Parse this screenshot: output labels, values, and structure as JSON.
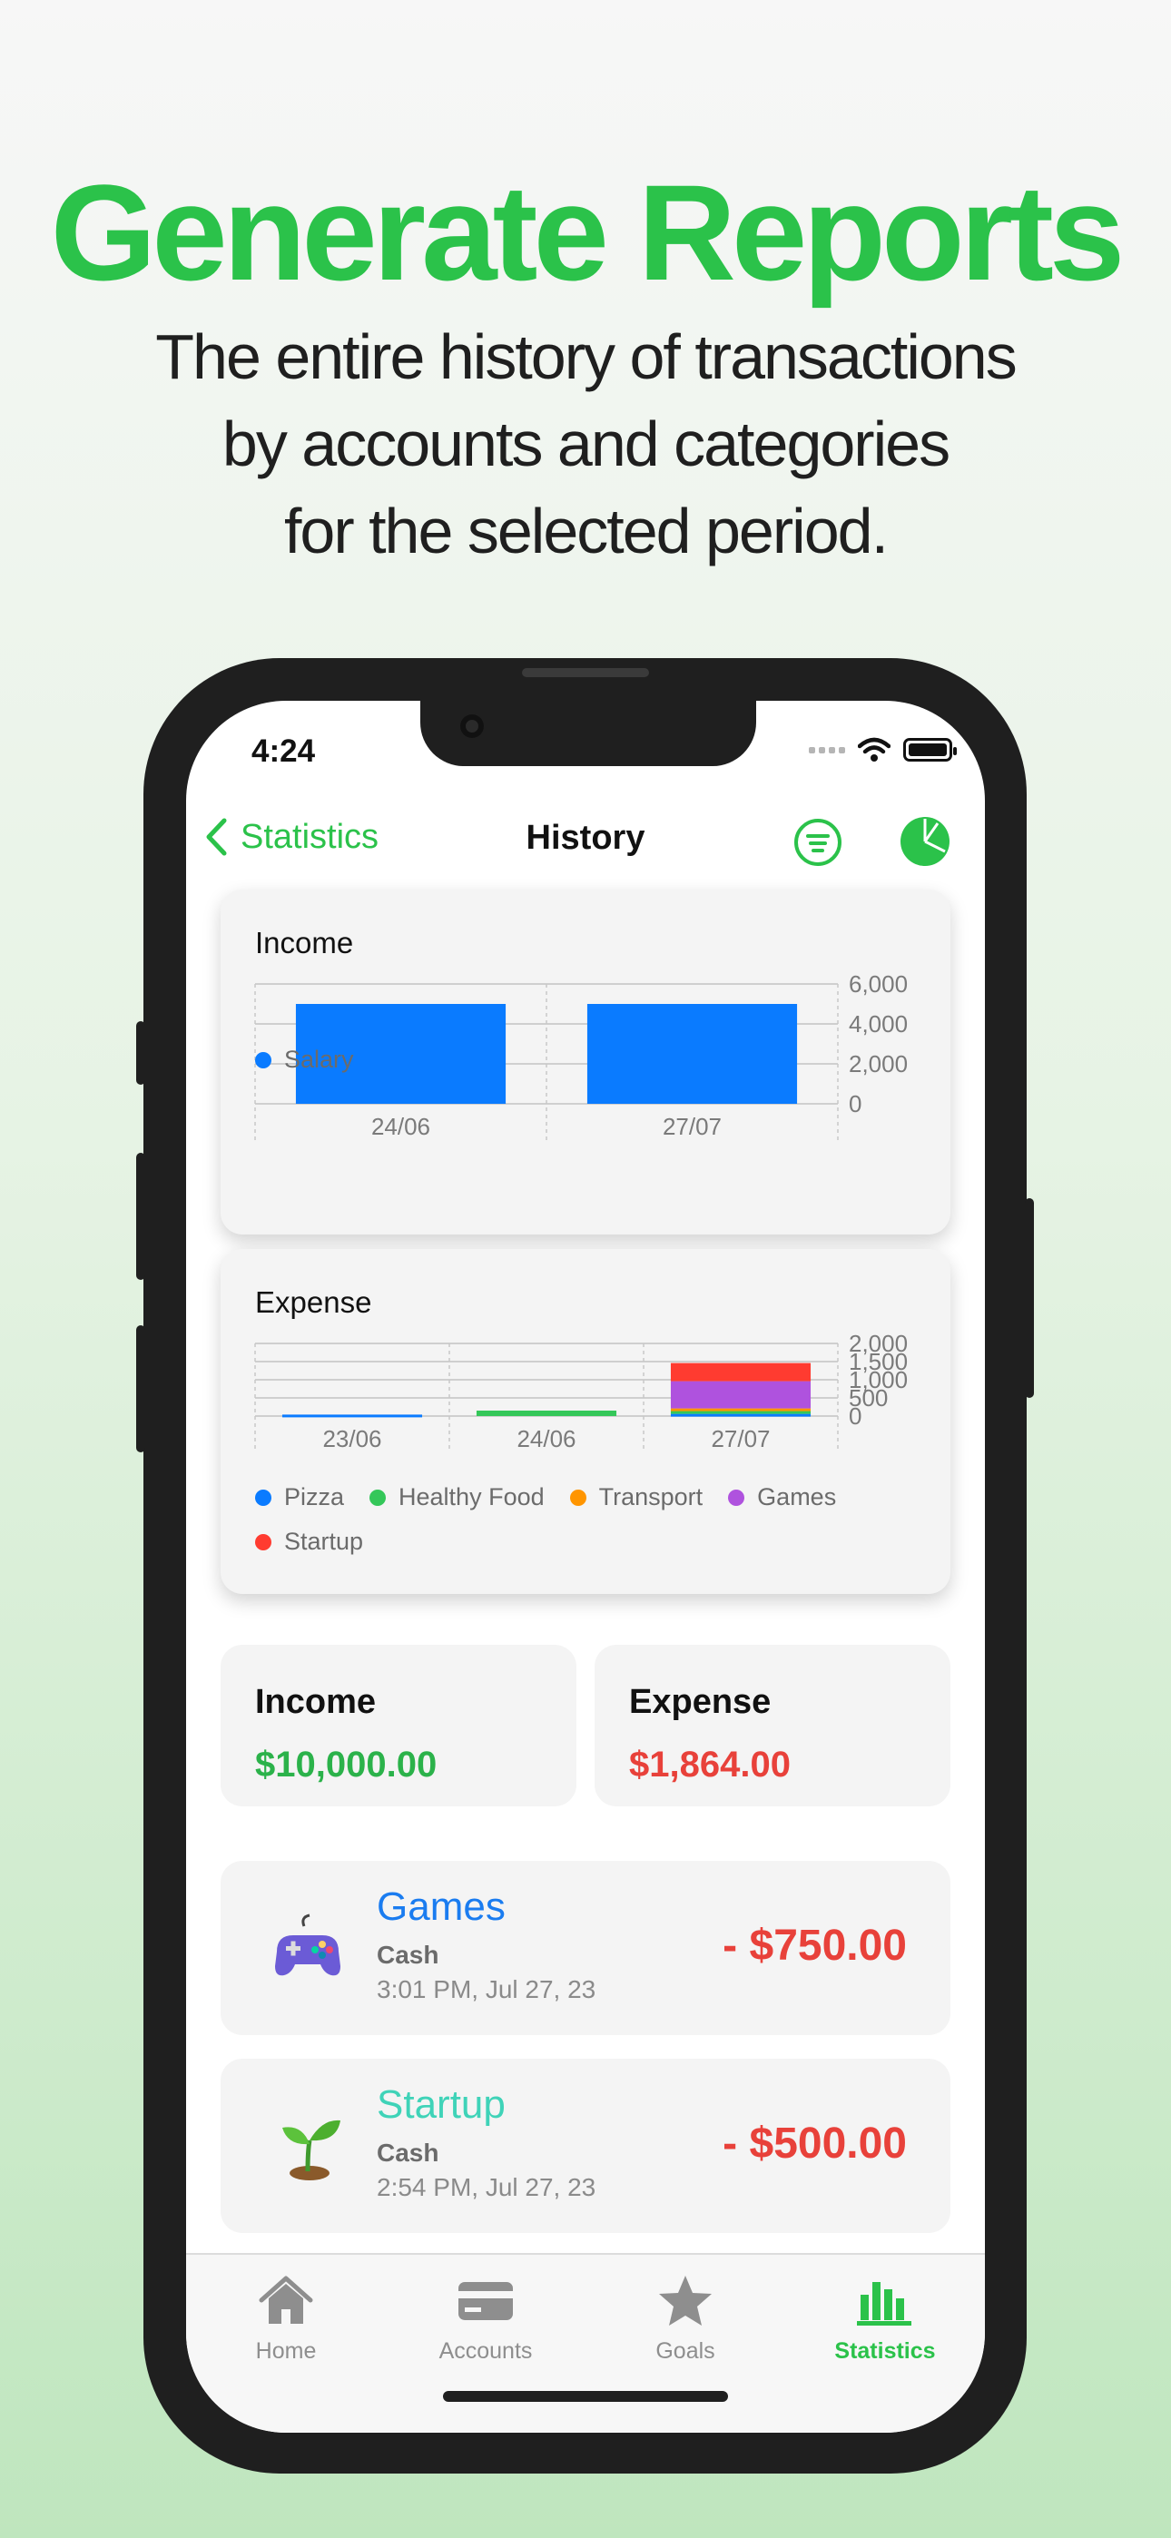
{
  "marketing": {
    "headline": "Generate Reports",
    "subline_1": "The entire history of transactions",
    "subline_2": "by accounts and categories",
    "subline_3": "for the selected period."
  },
  "status_bar": {
    "time": "4:24"
  },
  "nav": {
    "back_label": "Statistics",
    "title": "History",
    "filter_icon": "filter-lines-icon",
    "pie_icon": "pie-chart-icon"
  },
  "colors": {
    "accent_green": "#2bc24a",
    "income_green": "#2bb24a",
    "expense_red": "#e8413a",
    "salary_blue": "#0a7bff",
    "pizza": "#0a7bff",
    "healthy_food": "#34c759",
    "transport": "#ff9500",
    "games": "#af52de",
    "startup": "#ff3b30"
  },
  "chart_data": [
    {
      "type": "bar",
      "title": "Income",
      "categories": [
        "24/06",
        "27/07"
      ],
      "series": [
        {
          "name": "Salary",
          "color": "#0a7bff",
          "values": [
            5000,
            5000
          ]
        }
      ],
      "y_ticks": [
        "6,000",
        "4,000",
        "2,000",
        "0"
      ],
      "ylim": [
        0,
        6000
      ],
      "legend": "bottom-left",
      "grid": true
    },
    {
      "type": "bar",
      "stacked": true,
      "title": "Expense",
      "categories": [
        "23/06",
        "24/06",
        "27/07"
      ],
      "series": [
        {
          "name": "Pizza",
          "color": "#0a7bff",
          "values": [
            40,
            0,
            60
          ]
        },
        {
          "name": "Healthy Food",
          "color": "#34c759",
          "values": [
            0,
            150,
            100
          ]
        },
        {
          "name": "Transport",
          "color": "#ff9500",
          "values": [
            0,
            0,
            50
          ]
        },
        {
          "name": "Games",
          "color": "#af52de",
          "values": [
            0,
            0,
            750
          ]
        },
        {
          "name": "Startup",
          "color": "#ff3b30",
          "values": [
            0,
            0,
            500
          ]
        }
      ],
      "y_ticks": [
        "2,000",
        "1,500",
        "1,000",
        "500",
        "0"
      ],
      "ylim": [
        0,
        2000
      ],
      "legend": "bottom-left",
      "grid": true
    }
  ],
  "summary": {
    "income_label": "Income",
    "income_value": "$10,000.00",
    "expense_label": "Expense",
    "expense_value": "$1,864.00"
  },
  "transactions": [
    {
      "name": "Games",
      "account": "Cash",
      "date": "3:01 PM, Jul 27, 23",
      "amount": "- $750.00",
      "name_color": "#1a7cf0",
      "icon": "gamepad-icon"
    },
    {
      "name": "Startup",
      "account": "Cash",
      "date": "2:54 PM, Jul 27, 23",
      "amount": "- $500.00",
      "name_color": "#3fd3b8",
      "icon": "seedling-icon"
    }
  ],
  "tabs": [
    {
      "label": "Home",
      "icon": "house-icon",
      "active": false
    },
    {
      "label": "Accounts",
      "icon": "card-icon",
      "active": false
    },
    {
      "label": "Goals",
      "icon": "star-icon",
      "active": false
    },
    {
      "label": "Statistics",
      "icon": "bar-chart-icon",
      "active": true
    }
  ]
}
